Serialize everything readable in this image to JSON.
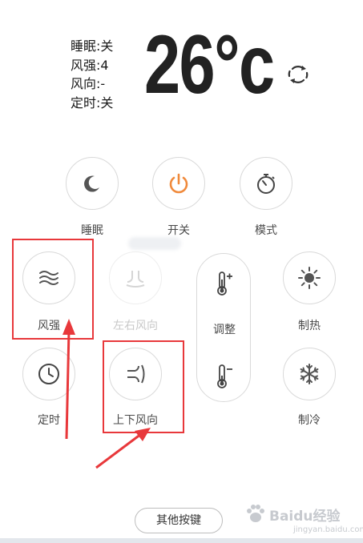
{
  "status": {
    "sleep": "睡眠:关",
    "wind_strength": "风强:4",
    "wind_direction": "风向:-",
    "timer": "定时:关"
  },
  "temperature": {
    "value": "26",
    "unit": "°c"
  },
  "buttons": {
    "sleep": "睡眠",
    "power": "开关",
    "mode": "模式",
    "wind_strength": "风强",
    "horizontal_swing": "左右风向",
    "adjust": "调整",
    "heat": "制热",
    "timer": "定时",
    "vertical_swing": "上下风向",
    "cool": "制冷",
    "more": "其他按键"
  },
  "icons": {
    "refresh": "refresh-icon",
    "sleep": "moon-icon",
    "power": "power-icon",
    "mode": "stopwatch-icon",
    "wind_strength": "wind-waves-icon",
    "horizontal_swing": "horizontal-swing-icon",
    "temp_up": "thermometer-plus-icon",
    "temp_down": "thermometer-minus-icon",
    "heat": "sun-icon",
    "timer": "clock-icon",
    "vertical_swing": "vertical-swing-icon",
    "cool": "snowflake-icon"
  },
  "colors": {
    "power_accent": "#f08a3c",
    "annotation_red": "#e8383b",
    "disabled": "#c8c8c8"
  },
  "watermark": {
    "brand": "Baidu经验",
    "url": "jingyan.baidu.com"
  }
}
